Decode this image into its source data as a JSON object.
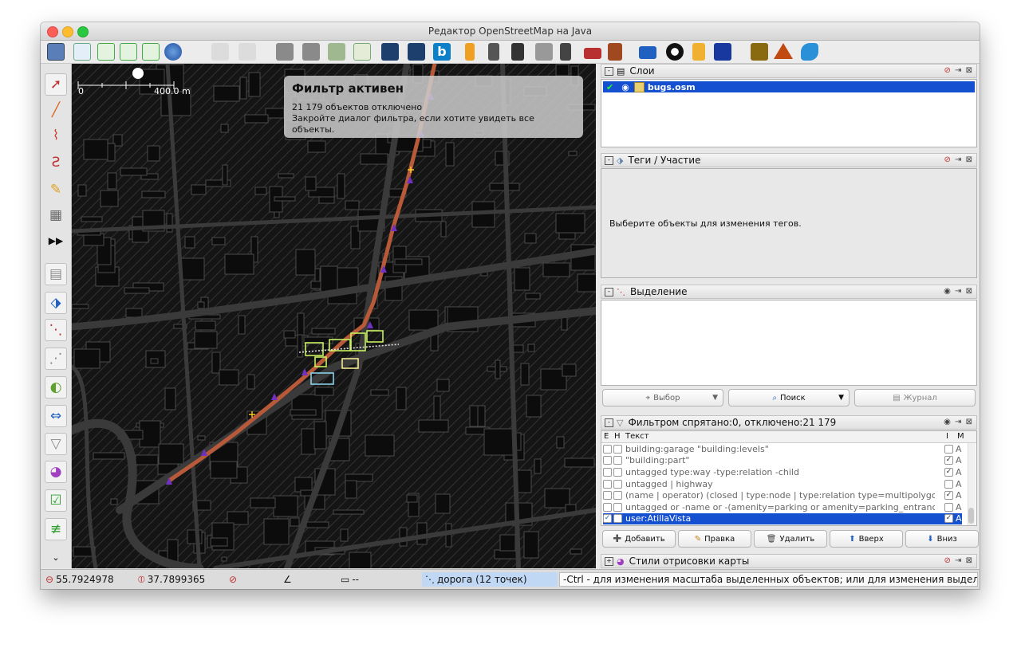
{
  "window": {
    "title": "Редактор OpenStreetMap на Java"
  },
  "map": {
    "scale_start": "0",
    "scale_end": "400.0 m",
    "filter_heading": "Фильтр активен",
    "filter_line1": "21 179 объектов отключено",
    "filter_line2": "Закройте диалог фильтра, если хотите увидеть все объекты."
  },
  "layers_panel": {
    "title": "Слои",
    "layer_name": "bugs.osm"
  },
  "tags_panel": {
    "title": "Теги / Участие",
    "empty_text": "Выберите объекты для изменения тегов."
  },
  "selection_panel": {
    "title": "Выделение",
    "select_label": "Выбор",
    "search_label": "Поиск",
    "history_label": "Журнал"
  },
  "filter_panel": {
    "title": "Фильтром спрятано:0, отключено:21 179",
    "col_e": "E",
    "col_h": "H",
    "col_text": "Текст",
    "col_i": "I",
    "col_m": "M",
    "rows": [
      {
        "text": "building:garage \"building:levels\"",
        "i": false,
        "m": "A",
        "e": false,
        "selected": false
      },
      {
        "text": "\"building:part\"",
        "i": true,
        "m": "A",
        "e": false,
        "selected": false
      },
      {
        "text": "untagged type:way -type:relation  -child",
        "i": true,
        "m": "A",
        "e": false,
        "selected": false
      },
      {
        "text": "untagged | highway",
        "i": false,
        "m": "A",
        "e": false,
        "selected": false
      },
      {
        "text": "(name | operator) (closed |  type:node |  type:relation type=multipolygon )",
        "i": true,
        "m": "A",
        "e": false,
        "selected": false
      },
      {
        "text": "untagged or -name or -(amenity=parking or amenity=parking_entrance)",
        "i": false,
        "m": "A",
        "e": false,
        "selected": false
      },
      {
        "text": "user:AtillaVista",
        "i": true,
        "m": "A",
        "e": true,
        "selected": true
      }
    ],
    "add_label": "Добавить",
    "edit_label": "Правка",
    "delete_label": "Удалить",
    "up_label": "Вверх",
    "down_label": "Вниз"
  },
  "styles_panel": {
    "title": "Стили отрисовки карты"
  },
  "statusbar": {
    "lat": "55.7924978",
    "lon": "37.7899365",
    "distance": "--",
    "selection": "дорога (12 точек)",
    "hint": "-Ctrl - для изменения масштаба выделенных объектов; или для изменения выделения"
  },
  "colors": {
    "selected_row": "#1550d0",
    "route": "#b85a3a",
    "route_node": "#7030c0",
    "highlight": "#c8f060"
  }
}
